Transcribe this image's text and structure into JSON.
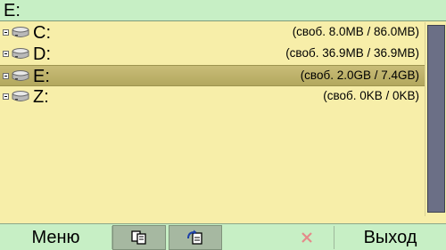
{
  "title": "E:",
  "drives": [
    {
      "name": "C:",
      "info": "(своб. 8.0MB / 86.0MB)",
      "selected": false
    },
    {
      "name": "D:",
      "info": "(своб. 36.9MB / 36.9MB)",
      "selected": false
    },
    {
      "name": "E:",
      "info": "(своб. 2.0GB / 7.4GB)",
      "selected": true
    },
    {
      "name": "Z:",
      "info": "(своб. 0KB / 0KB)",
      "selected": false
    }
  ],
  "toolbar": {
    "menu_label": "Меню",
    "copy_icon": "copy-icon",
    "move_icon": "move-icon",
    "delete_icon": "delete-icon",
    "exit_label": "Выход"
  },
  "colors": {
    "list_background": "#f7eea9",
    "bar_background": "#c7efc5",
    "selection": "#b8ad66",
    "scroll_thumb": "#6b6f86",
    "delete_icon_color": "#e58a8a"
  }
}
